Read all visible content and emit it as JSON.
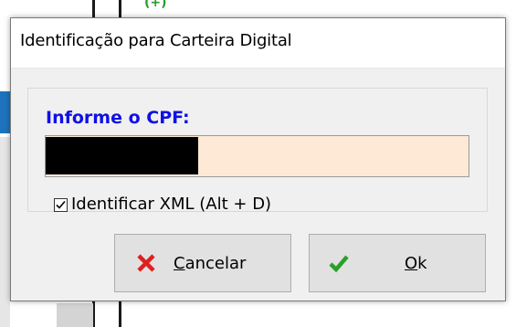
{
  "background": {
    "partial_text": "(+)"
  },
  "dialog": {
    "title": "Identificação para Carteira Digital",
    "cpf_label": "Informe o CPF:",
    "cpf_value": "",
    "identify_xml": {
      "label": "Identificar XML (Alt + D)",
      "checked": true
    },
    "buttons": {
      "cancel": {
        "mnemonic": "C",
        "rest": "ancelar",
        "icon": "red-x-icon"
      },
      "ok": {
        "mnemonic": "O",
        "rest": "k",
        "icon": "green-check-icon"
      }
    }
  },
  "colors": {
    "label_blue": "#1010e6",
    "input_bg": "#fde9d5",
    "cancel_red": "#e02020",
    "ok_green": "#2aa02a"
  }
}
